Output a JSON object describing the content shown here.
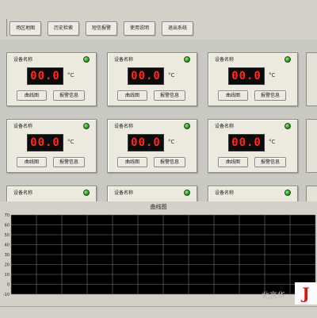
{
  "toolbar": {
    "buttons": [
      {
        "label": "场区地图"
      },
      {
        "label": "历史检索"
      },
      {
        "label": "短信报警"
      },
      {
        "label": "使用说明"
      },
      {
        "label": "退出系统"
      }
    ]
  },
  "devices": [
    {
      "name": "设备名称",
      "value": "00.0",
      "unit": "°C",
      "led": "on",
      "curve_label": "曲线图",
      "alarm_label": "报警信息"
    },
    {
      "name": "设备名称",
      "value": "00.0",
      "unit": "°C",
      "led": "on",
      "curve_label": "曲线图",
      "alarm_label": "报警信息"
    },
    {
      "name": "设备名称",
      "value": "00.0",
      "unit": "°C",
      "led": "on",
      "curve_label": "曲线图",
      "alarm_label": "报警信息"
    },
    {
      "name": "设备名称",
      "value": "00.0",
      "unit": "°C",
      "led": "on",
      "curve_label": "曲线图",
      "alarm_label": "报警信息"
    },
    {
      "name": "设备名称",
      "value": "00.0",
      "unit": "°C",
      "led": "on",
      "curve_label": "曲线图",
      "alarm_label": "报警信息"
    },
    {
      "name": "设备名称",
      "value": "00.0",
      "unit": "°C",
      "led": "on",
      "curve_label": "曲线图",
      "alarm_label": "报警信息"
    },
    {
      "name": "设备名称",
      "led": "on"
    },
    {
      "name": "设备名称",
      "led": "on"
    },
    {
      "name": "设备名称",
      "led": "on"
    }
  ],
  "chart": {
    "title": "曲线图",
    "y_ticks": [
      "70",
      "60",
      "50",
      "40",
      "30",
      "20",
      "10",
      "0",
      "-10"
    ],
    "background": "#000000",
    "grid_color": "#7a7a7a"
  },
  "watermark": "北京华",
  "logo_text": "J"
}
